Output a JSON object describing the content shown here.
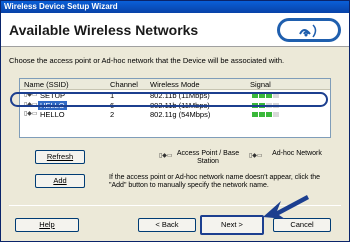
{
  "window": {
    "title": "Wireless Device Setup Wizard"
  },
  "header": {
    "title": "Available Wireless Networks"
  },
  "instruction": "Choose the access point or Ad-hoc network that the Device will be associated with.",
  "table": {
    "columns": [
      "Name (SSID)",
      "Channel",
      "Wireless Mode",
      "Signal"
    ],
    "rows": [
      {
        "ssid": "SETUP",
        "channel": "1",
        "mode": "802.11b (11Mbps)",
        "signal": 0.6,
        "type": "adhoc",
        "selected": false
      },
      {
        "ssid": "HELLO",
        "channel": "6",
        "mode": "802.11b (11Mbps)",
        "signal": 0.4,
        "type": "adhoc",
        "selected": true
      },
      {
        "ssid": "HELLO",
        "channel": "2",
        "mode": "802.11g (54Mbps)",
        "signal": 0.6,
        "type": "adhoc",
        "selected": false
      }
    ]
  },
  "buttons": {
    "refresh": "Refresh",
    "add": "Add",
    "help": "Help",
    "back": "< Back",
    "next": "Next >",
    "cancel": "Cancel"
  },
  "legend": {
    "access_point": "Access Point / Base Station",
    "adhoc": "Ad-hoc Network"
  },
  "add_help": "If the access point or Ad-hoc network name doesn't appear, click the \"Add\" button to manually specify the network name.",
  "colors": {
    "selection": "#316ac5",
    "highlight": "#1c3f8f",
    "signal": "#3ab83a"
  },
  "icons": {
    "logo": "wireless-logo-icon",
    "adhoc": "adhoc-network-icon",
    "access_point": "access-point-icon",
    "arrow": "pointer-arrow-icon"
  }
}
